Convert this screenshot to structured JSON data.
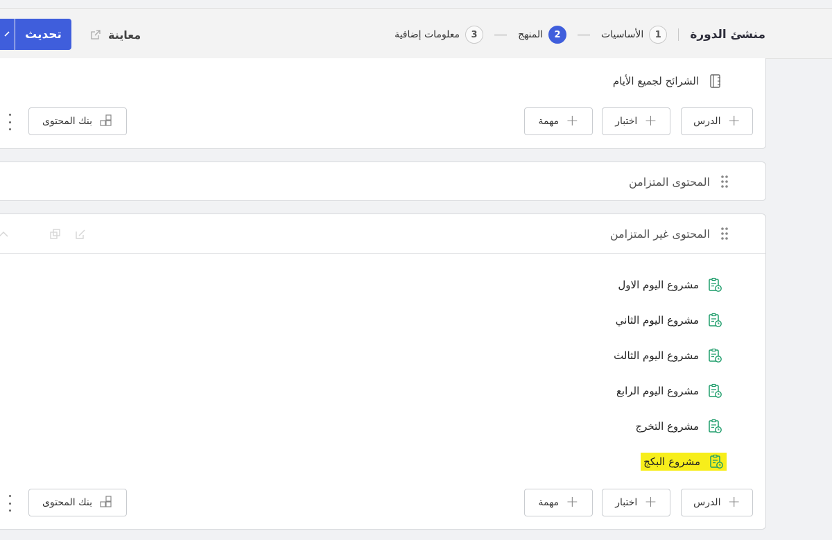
{
  "header": {
    "builder_title": "منشئ الدورة",
    "steps": [
      {
        "num": "1",
        "label": "الأساسيات",
        "active": false
      },
      {
        "num": "2",
        "label": "المنهج",
        "active": true
      },
      {
        "num": "3",
        "label": "معلومات إضافية",
        "active": false
      }
    ],
    "preview_label": "معاينة",
    "update_label": "تحديث",
    "accent_color": "#3f5edc"
  },
  "days_panel": {
    "slides_label": "الشرائح لجميع الأيام",
    "buttons": {
      "lesson": "الدرس",
      "quiz": "اختبار",
      "task": "مهمة",
      "content_bank": "بنك المحتوى"
    }
  },
  "sync_section": {
    "title": "المحتوى المتزامن"
  },
  "async_section": {
    "title": "المحتوى غير المتزامن",
    "items": [
      {
        "label": "مشروع اليوم الاول"
      },
      {
        "label": "مشروع اليوم الثاني"
      },
      {
        "label": "مشروع اليوم الثالث"
      },
      {
        "label": "مشروع اليوم الرابع"
      },
      {
        "label": "مشروع التخرج"
      },
      {
        "label": "مشروع البكج"
      }
    ],
    "buttons": {
      "lesson": "الدرس",
      "quiz": "اختبار",
      "task": "مهمة",
      "content_bank": "بنك المحتوى"
    },
    "item_icon_color": "#1f9d6b",
    "highlight_color": "#f7ee1b"
  }
}
